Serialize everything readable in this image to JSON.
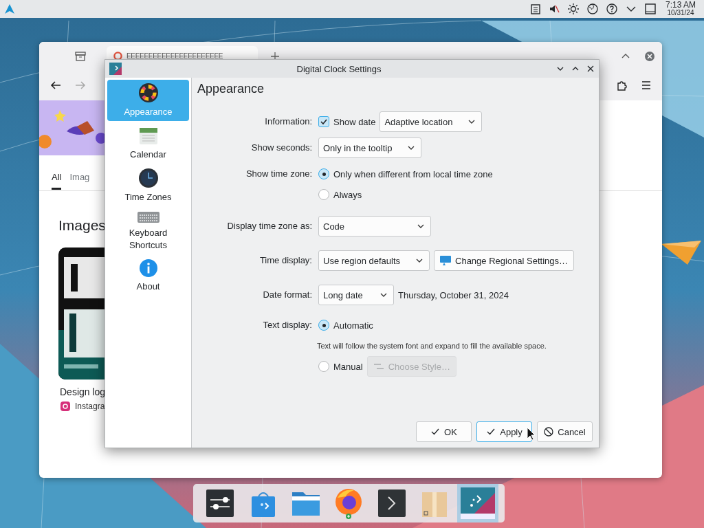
{
  "panel": {
    "time": "7:13 AM",
    "date": "10/31/24"
  },
  "browser": {
    "tab_title": "EEEEEEEEEEEEEEEEEEEEEE",
    "result_tabs": [
      {
        "label": "All",
        "selected": true
      },
      {
        "label": "Imag",
        "selected": false
      }
    ],
    "section_heading": "Images",
    "result_title": "Design log",
    "result_source": "Instagra"
  },
  "dialog": {
    "title": "Digital Clock Settings",
    "sidebar": [
      {
        "label": "Appearance",
        "selected": true
      },
      {
        "label": "Calendar",
        "selected": false
      },
      {
        "label": "Time Zones",
        "selected": false
      },
      {
        "label": "Keyboard Shortcuts",
        "selected": false
      },
      {
        "label": "About",
        "selected": false
      }
    ],
    "heading": "Appearance",
    "rows": [
      {
        "label": "Information:",
        "lines": [
          [
            {
              "kind": "checkbox",
              "label": "Show date",
              "checked": true
            },
            {
              "kind": "combo",
              "value": "Adaptive location"
            }
          ]
        ]
      },
      {
        "label": "Show seconds:",
        "lines": [
          [
            {
              "kind": "combo",
              "value": "Only in the tooltip"
            }
          ]
        ]
      },
      {
        "label": "Show time zone:",
        "lines": [
          [
            {
              "kind": "radio",
              "label": "Only when different from local time zone",
              "selected": true
            }
          ],
          [
            {
              "kind": "radio",
              "label": "Always",
              "selected": false
            }
          ]
        ]
      },
      {
        "label": "Display time zone as:",
        "lines": [
          [
            {
              "kind": "combo",
              "value": "Code"
            }
          ]
        ]
      },
      {
        "label": "Time display:",
        "lines": [
          [
            {
              "kind": "combo",
              "value": "Use region defaults"
            },
            {
              "kind": "button",
              "label": "Change Regional Settings…",
              "disabled": false
            }
          ]
        ]
      },
      {
        "label": "Date format:",
        "lines": [
          [
            {
              "kind": "combo",
              "value": "Long date"
            },
            {
              "kind": "text",
              "text": "Thursday, October 31, 2024"
            }
          ]
        ]
      },
      {
        "label": "Text display:",
        "lines": [
          [
            {
              "kind": "radio",
              "label": "Automatic",
              "selected": true
            }
          ],
          [
            {
              "kind": "note",
              "text": "Text will follow the system font and expand to fill the available space."
            }
          ],
          [
            {
              "kind": "radio",
              "label": "Manual",
              "selected": false
            },
            {
              "kind": "button",
              "label": "Choose Style…",
              "disabled": true
            }
          ]
        ]
      }
    ],
    "buttons": [
      {
        "label": "OK",
        "kind": "ok",
        "focused": false
      },
      {
        "label": "Apply",
        "kind": "ok",
        "focused": true
      },
      {
        "label": "Cancel",
        "kind": "cancel",
        "focused": false
      }
    ]
  },
  "dock": [
    {
      "active": false
    },
    {
      "active": false
    },
    {
      "active": false
    },
    {
      "active": false
    },
    {
      "active": false
    },
    {
      "active": false
    },
    {
      "active": true
    }
  ]
}
